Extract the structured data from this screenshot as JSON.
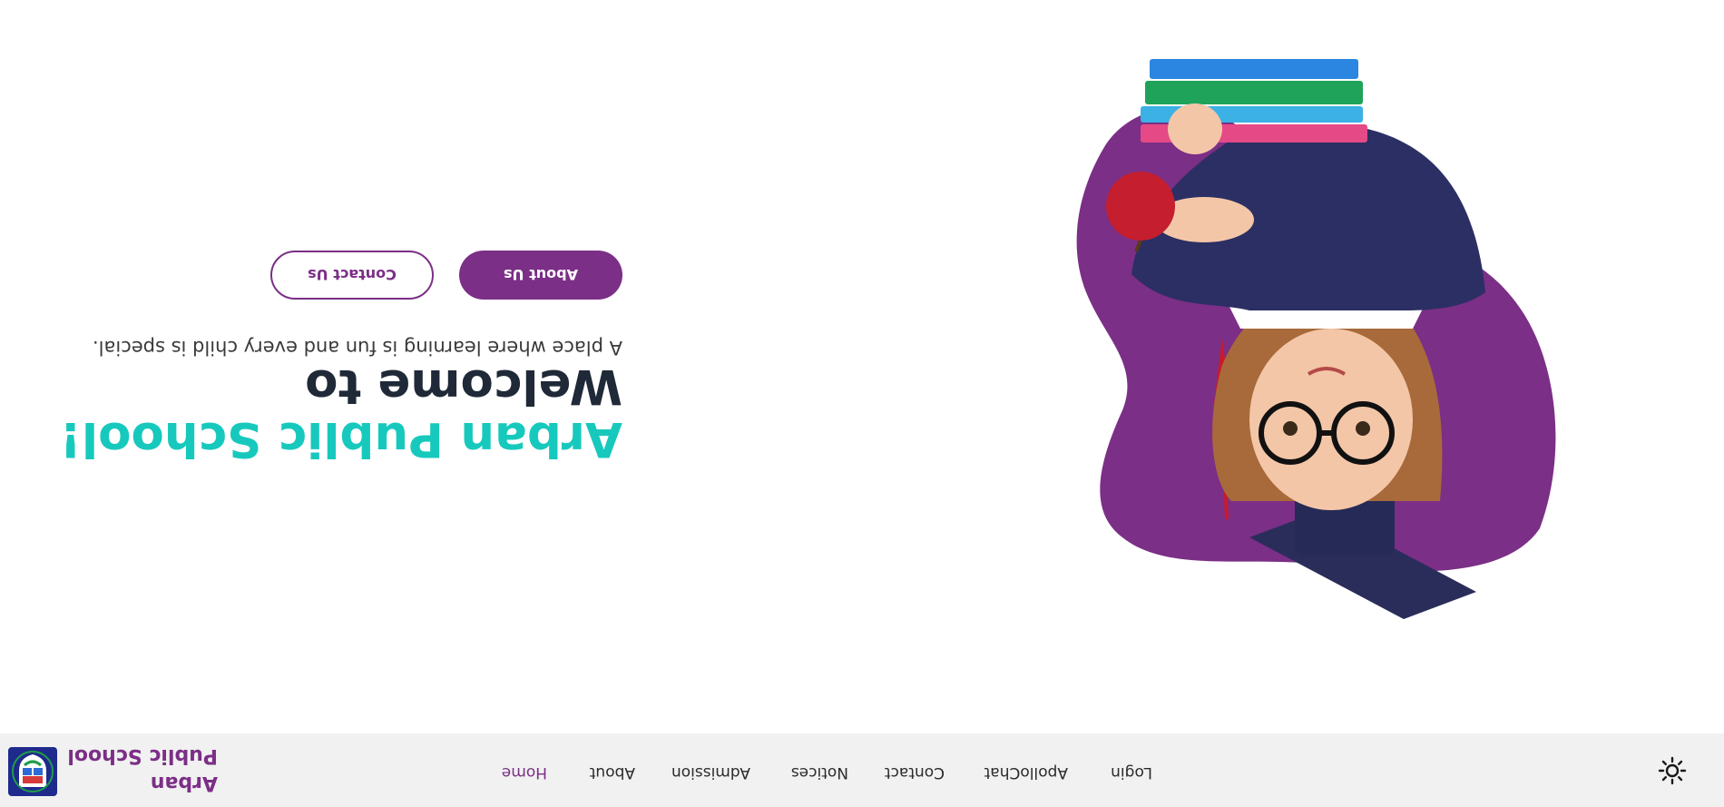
{
  "brand": {
    "name_line1": "Arban",
    "name_line2": "Public School"
  },
  "nav": {
    "items": [
      {
        "label": "Home",
        "active": true
      },
      {
        "label": "About",
        "active": false
      },
      {
        "label": "Admission",
        "active": false
      },
      {
        "label": "Notices",
        "active": false
      },
      {
        "label": "Contact",
        "active": false
      },
      {
        "label": "ApolloChat",
        "active": false
      },
      {
        "label": "Login",
        "active": false
      }
    ],
    "theme_toggle_icon": "sun-icon"
  },
  "hero": {
    "title_line1": "Welcome to",
    "title_line2": "Arban Public School!",
    "subtitle": "A place where learning is fun and every child is special.",
    "primary_button": "About Us",
    "secondary_button": "Contact Us",
    "image_icon": "student-with-books-illustration"
  },
  "colors": {
    "brand_purple": "#7b2f86",
    "accent_teal": "#17c9bd",
    "heading_dark": "#1f2937",
    "nav_bg": "#f1f1f1"
  }
}
